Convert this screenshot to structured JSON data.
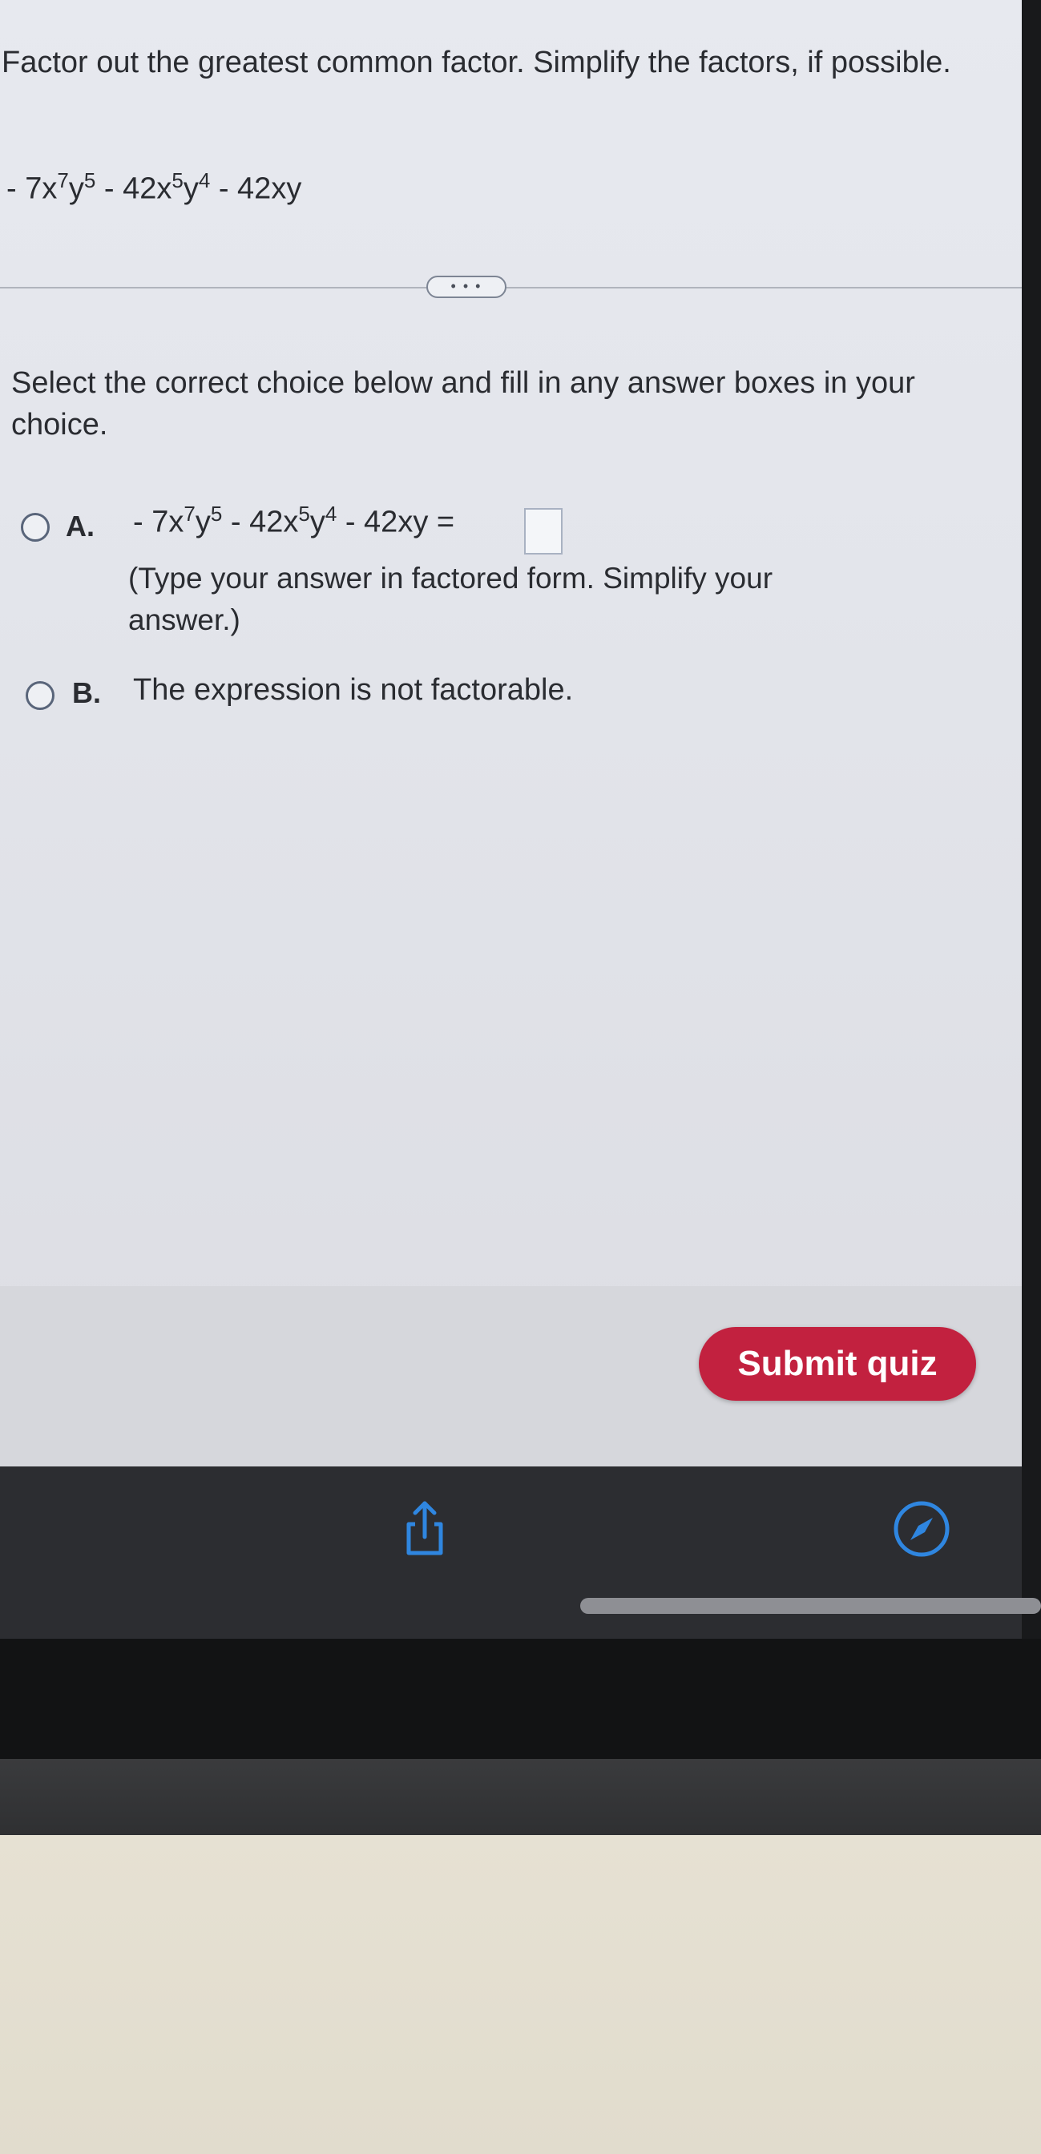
{
  "question": {
    "prompt": "Factor out the greatest common factor. Simplify the factors, if possible.",
    "expression_parts": {
      "t1_coef": "- 7x",
      "t1_exp1": "7",
      "t1_var2": "y",
      "t1_exp2": "5",
      "t2_coef": " - 42x",
      "t2_exp1": "5",
      "t2_var2": "y",
      "t2_exp2": "4",
      "t3": " - 42xy"
    }
  },
  "expand_button": {
    "label": "• • •"
  },
  "instructions": "Select the correct choice below and fill in any answer boxes in your choice.",
  "choices": [
    {
      "letter": "A.",
      "equation_suffix": " =",
      "answer_value": "",
      "hint": "(Type your answer in factored form. Simplify your answer.)"
    },
    {
      "letter": "B.",
      "text": "The expression is not factorable."
    }
  ],
  "submit_button": {
    "label": "Submit quiz"
  },
  "browser_toolbar": {
    "icons": [
      "share-icon",
      "compass-icon"
    ]
  },
  "colors": {
    "submit_bg": "#c2213f",
    "toolbar_bg": "#2c2d31",
    "accent_top": "#b8404a"
  }
}
